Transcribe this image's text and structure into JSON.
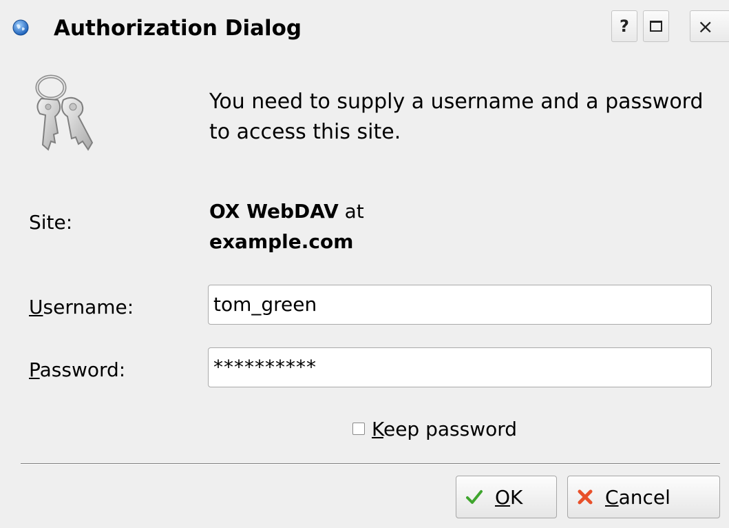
{
  "window": {
    "title": "Authorization Dialog",
    "icon": "globe-icon",
    "controls": {
      "help": "?",
      "maximize": "maximize-icon",
      "close": "×"
    }
  },
  "dialog": {
    "icon": "keys-icon",
    "message": "You need to supply a username and a password to access this site.",
    "site_label": "Site:",
    "site_name": "OX WebDAV",
    "site_at": " at",
    "site_host": "example.com",
    "username": {
      "label_mnemonic": "U",
      "label_rest": "sername:",
      "value": "tom_green"
    },
    "password": {
      "label_mnemonic": "P",
      "label_rest": "assword:",
      "value": "**********"
    },
    "keep_password": {
      "checked": false,
      "label_mnemonic": "K",
      "label_rest": "eep password"
    }
  },
  "buttons": {
    "ok": {
      "mnemonic": "O",
      "rest": "K",
      "icon": "checkmark-icon",
      "icon_color": "#3fa52e"
    },
    "cancel": {
      "mnemonic": "C",
      "rest": "ancel",
      "icon": "cross-icon",
      "icon_color": "#e8502a"
    }
  }
}
